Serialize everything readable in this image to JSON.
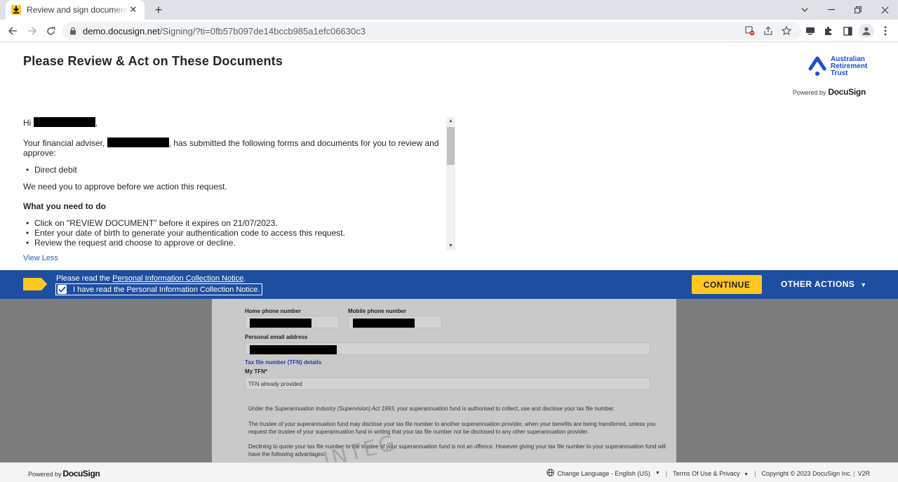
{
  "browser": {
    "tab_title": "Review and sign document(s) | DocuSign",
    "url_host": "demo.docusign.net",
    "url_path": "/Signing/?ti=0fb57b097de14bccb985a1efc06630c3"
  },
  "header": {
    "title": "Please Review & Act on These Documents",
    "brand_line1": "Australian",
    "brand_line2": "Retirement",
    "brand_line3": "Trust",
    "powered_by": "Powered by",
    "docusign": "DocuSign"
  },
  "message": {
    "greeting": "Hi",
    "greeting_end": ",",
    "intro_start": "Your financial adviser,",
    "intro_end": ", has submitted the following forms and documents for you to review and approve:",
    "documents": [
      "Direct debit"
    ],
    "approve_note": "We need you to approve before we action this request.",
    "todo_heading": "What you need to do",
    "todo_items": [
      "Click on \"REVIEW DOCUMENT\" before it expires on 21/07/2023.",
      "Enter your date of birth to generate your authentication code to access this request.",
      "Review the request and choose to approve or decline."
    ],
    "view_less": "View Less"
  },
  "actionbar": {
    "notice_prefix": "Please read the",
    "notice_link": "Personal Information Collection Notice",
    "notice_suffix": ".",
    "ack_label": "I have read the Personal Information Collection Notice.",
    "ack_checked": true,
    "continue_label": "CONTINUE",
    "other_actions_label": "OTHER ACTIONS",
    "accent_color": "#ffc820",
    "bar_color": "#1e4ea0"
  },
  "document": {
    "home_phone_label": "Home phone number",
    "mobile_phone_label": "Mobile phone number",
    "email_label": "Personal email address",
    "tfn_section": "Tax file number (TFN) details",
    "tfn_label": "My TFN*",
    "tfn_value": "TFN already provided",
    "para1_pre": "Under the ",
    "para1_act": "Superannuation Industry (Supervision) Act 1993",
    "para1_post": ", your superannuation fund is authorised to collect, use and disclose your tax file number.",
    "para2": "The trustee of your superannuation fund may disclose your tax file number to another superannuation provider, when your benefits are being transferred, unless you request the trustee of your superannuation fund in writing that your tax file number not be disclosed to any other superannuation provider.",
    "para3": "Declining to quote your tax file number to the trustee of your superannuation fund is not an offence. However giving your tax file number to your superannuation fund will have the following advantages:",
    "watermark": "INTEG"
  },
  "footer": {
    "powered_by": "Powered by",
    "docusign": "DocuSign",
    "language": "Change Language - English (US)",
    "terms": "Terms Of Use & Privacy",
    "copyright": "Copyright © 2023 DocuSign Inc.",
    "version": "V2R"
  }
}
